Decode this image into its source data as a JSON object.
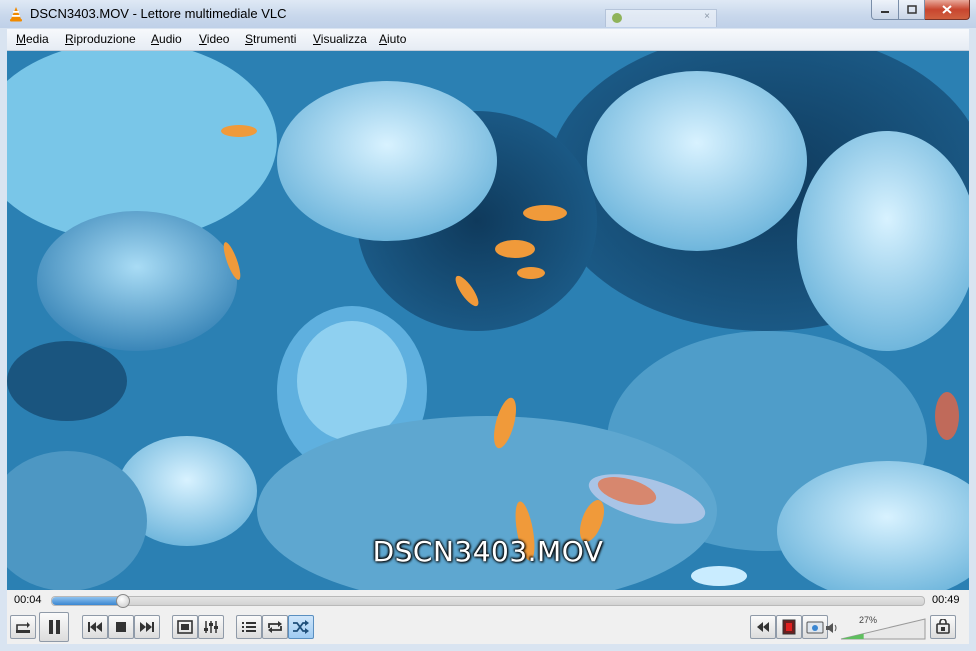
{
  "window": {
    "title": "DSCN3403.MOV - Lettore multimediale VLC",
    "controls": {
      "minimize": "—",
      "maximize": "□",
      "close": "✕"
    }
  },
  "menu": [
    {
      "label": "Media",
      "underline": "M",
      "rest": "edia"
    },
    {
      "label": "Riproduzione",
      "underline": "R",
      "rest": "iproduzione"
    },
    {
      "label": "Audio",
      "underline": "A",
      "rest": "udio"
    },
    {
      "label": "Video",
      "underline": "V",
      "rest": "ideo"
    },
    {
      "label": "Strumenti",
      "underline": "S",
      "rest": "trumenti"
    },
    {
      "label": "Visualizza",
      "underline": "V",
      "rest": "isualizza"
    },
    {
      "label": "Aiuto",
      "underline": "A",
      "rest": "iuto"
    }
  ],
  "video": {
    "subtitle": "DSCN3403.MOV"
  },
  "playback": {
    "elapsed": "00:04",
    "total": "00:49",
    "progress_fraction": 0.08
  },
  "volume": {
    "percent_label": "27%",
    "level_fraction": 0.27
  },
  "buttons": {
    "ab_loop": "loop-ab-icon",
    "pause": "pause-icon",
    "previous": "previous-icon",
    "stop": "stop-icon",
    "next": "next-icon",
    "fullscreen": "fullscreen-icon",
    "extended_settings": "equalizer-icon",
    "playlist": "playlist-icon",
    "loop": "repeat-icon",
    "random": "shuffle-icon",
    "frame_back": "rewind-icon",
    "record": "record-icon",
    "snapshot": "snapshot-icon",
    "speaker": "speaker-icon",
    "frame_step": "frame-step-icon"
  },
  "colors": {
    "seek_fill": "#3a86d1",
    "active_button": "#9fcbf2",
    "vlc_orange": "#f08a00"
  }
}
